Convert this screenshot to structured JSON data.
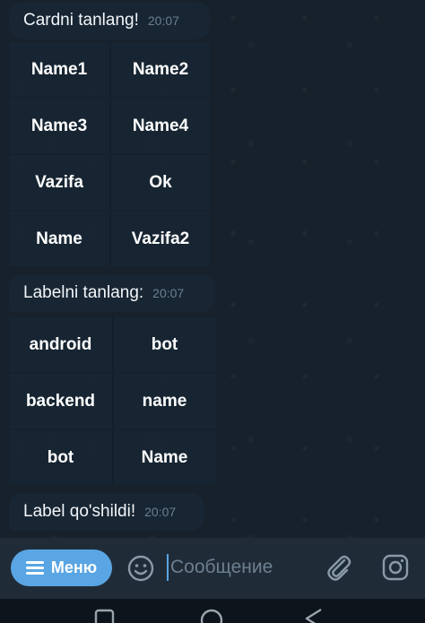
{
  "messages": [
    {
      "text": "Cardni tanlang!",
      "time": "20:07"
    },
    {
      "text": "Labelni tanlang:",
      "time": "20:07"
    },
    {
      "text": "Label qo'shildi!",
      "time": "20:07"
    }
  ],
  "keyboard1": [
    [
      "Name1",
      "Name2"
    ],
    [
      "Name3",
      "Name4"
    ],
    [
      "Vazifa",
      "Ok"
    ],
    [
      "Name",
      "Vazifa2"
    ]
  ],
  "keyboard2": [
    [
      "android",
      "bot"
    ],
    [
      "backend",
      "name"
    ],
    [
      "bot",
      "Name"
    ]
  ],
  "input": {
    "menu_label": "Меню",
    "placeholder": "Сообщение"
  },
  "icons": {
    "menu": "hamburger-icon",
    "emoji": "smile-icon",
    "attach": "paperclip-icon",
    "camera": "camera-icon",
    "nav": [
      "nav-home-icon",
      "nav-recents-icon",
      "nav-back-icon"
    ]
  },
  "colors": {
    "chat_bg": "#17212b",
    "bubble_bg": "#182533",
    "accent": "#5aa5e3",
    "time_text": "#6d7f8f"
  }
}
